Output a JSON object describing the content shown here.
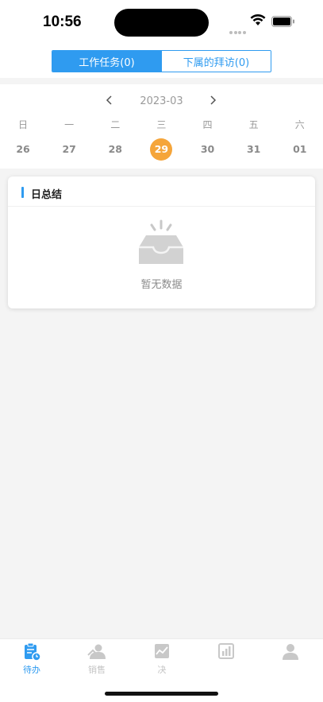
{
  "status": {
    "time": "10:56"
  },
  "segment": {
    "tabs": [
      {
        "label": "工作任务(0)",
        "active": true
      },
      {
        "label": "下属的拜访(0)",
        "active": false
      }
    ]
  },
  "calendar": {
    "month": "2023-03",
    "weekdays": [
      "日",
      "一",
      "二",
      "三",
      "四",
      "五",
      "六"
    ],
    "days": [
      "26",
      "27",
      "28",
      "29",
      "30",
      "31",
      "01"
    ],
    "selected": "29"
  },
  "summary": {
    "title": "日总结",
    "empty_text": "暂无数据"
  },
  "tabbar": {
    "items": [
      {
        "label": "待办",
        "icon": "todo-icon",
        "active": true
      },
      {
        "label": "销售",
        "icon": "sales-icon",
        "active": false
      },
      {
        "label": "决",
        "icon": "chart-line-icon",
        "active": false
      },
      {
        "label": "",
        "icon": "report-icon",
        "active": false
      },
      {
        "label": "",
        "icon": "user-icon",
        "active": false
      }
    ]
  },
  "colors": {
    "accent": "#2f9bf0",
    "selected_day": "#f5a53a",
    "background": "#f4f4f4"
  }
}
